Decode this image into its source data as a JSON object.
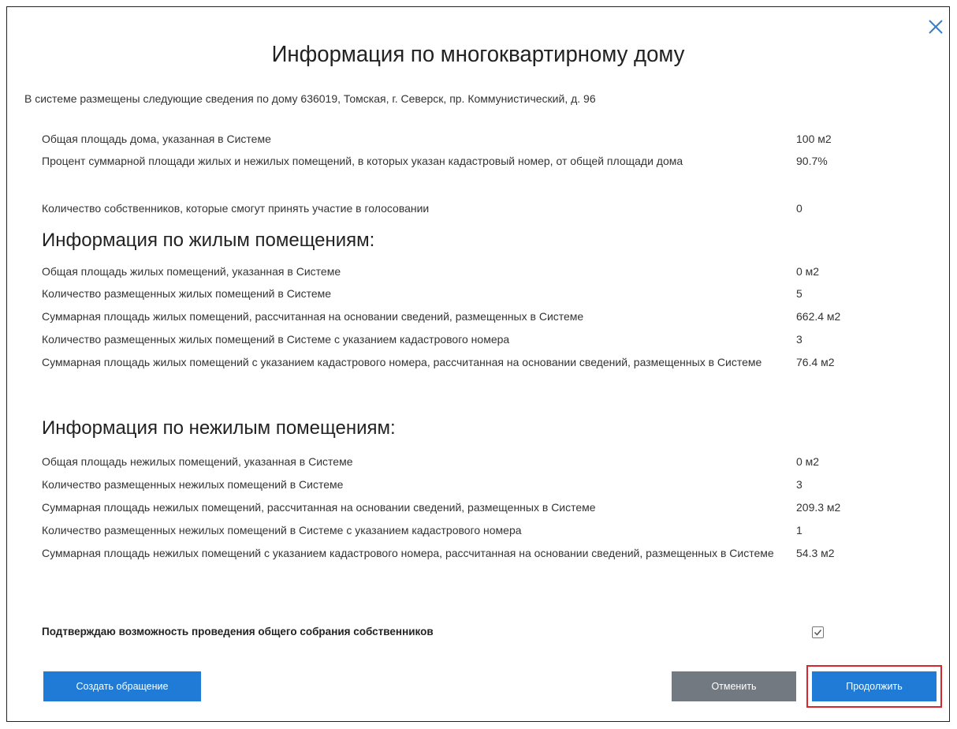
{
  "dialog": {
    "title": "Информация по многоквартирному дому",
    "intro": "В системе размещены следующие сведения по дому 636019, Томская, г. Северск, пр. Коммунистический, д. 96"
  },
  "general": [
    {
      "label": "Общая площадь дома, указанная в Системе",
      "value": "100 м2"
    },
    {
      "label": "Процент суммарной площади жилых и нежилых помещений, в которых указан кадастровый номер, от общей площади дома",
      "value": "90.7%"
    },
    {
      "label": "Количество собственников, которые смогут принять участие в голосовании",
      "value": "0"
    }
  ],
  "residential": {
    "heading": "Информация по жилым помещениям:",
    "rows": [
      {
        "label": "Общая площадь жилых помещений, указанная в Системе",
        "value": "0 м2"
      },
      {
        "label": "Количество размещенных жилых помещений в Системе",
        "value": "5"
      },
      {
        "label": "Суммарная площадь жилых помещений, рассчитанная на основании сведений, размещенных в Системе",
        "value": "662.4 м2"
      },
      {
        "label": "Количество размещенных жилых помещений в Системе с указанием кадастрового номера",
        "value": "3"
      },
      {
        "label": "Суммарная площадь жилых помещений с указанием кадастрового номера, рассчитанная на основании сведений, размещенных в Системе",
        "value": "76.4 м2"
      }
    ]
  },
  "nonresidential": {
    "heading": "Информация по нежилым помещениям:",
    "rows": [
      {
        "label": "Общая площадь нежилых помещений, указанная в Системе",
        "value": "0 м2"
      },
      {
        "label": "Количество размещенных нежилых помещений в Системе",
        "value": "3"
      },
      {
        "label": "Суммарная площадь нежилых помещений, рассчитанная на основании сведений, размещенных в Системе",
        "value": "209.3 м2"
      },
      {
        "label": "Количество размещенных нежилых помещений в Системе с указанием кадастрового номера",
        "value": "1"
      },
      {
        "label": "Суммарная площадь нежилых помещений с указанием кадастрового номера, рассчитанная на основании сведений, размещенных в Системе",
        "value": "54.3 м2"
      }
    ]
  },
  "confirm": {
    "label": "Подтверждаю возможность проведения общего собрания собственников",
    "checked": true
  },
  "buttons": {
    "create": "Создать обращение",
    "cancel": "Отменить",
    "continue": "Продолжить"
  },
  "colors": {
    "primary": "#1f7bd6",
    "secondary": "#737980",
    "highlight": "#d6262e"
  }
}
